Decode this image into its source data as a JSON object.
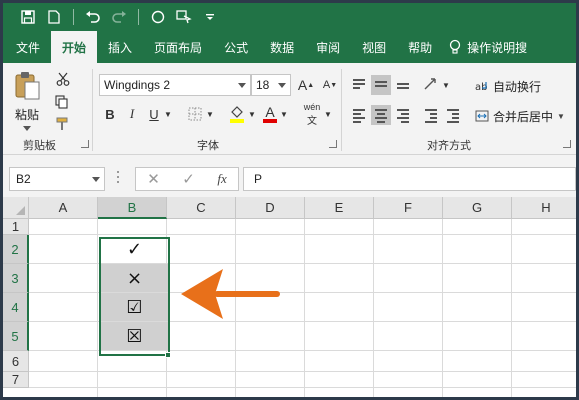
{
  "quick_access": {
    "icons": [
      "save-icon",
      "new-document-icon",
      "undo-icon",
      "redo-icon",
      "shape-icon",
      "touch-mode-icon",
      "customize-icon"
    ]
  },
  "tabs": [
    {
      "label": "文件",
      "active": false
    },
    {
      "label": "开始",
      "active": true
    },
    {
      "label": "插入",
      "active": false
    },
    {
      "label": "页面布局",
      "active": false
    },
    {
      "label": "公式",
      "active": false
    },
    {
      "label": "数据",
      "active": false
    },
    {
      "label": "审阅",
      "active": false
    },
    {
      "label": "视图",
      "active": false
    },
    {
      "label": "帮助",
      "active": false
    },
    {
      "label": "操作说明搜",
      "active": false
    }
  ],
  "ribbon": {
    "clipboard": {
      "paste_label": "粘贴",
      "group_label": "剪贴板"
    },
    "font": {
      "font_name": "Wingdings 2",
      "font_size": "18",
      "bold": "B",
      "italic": "I",
      "underline": "U",
      "font_color_glyph": "A",
      "phonetic": "wén",
      "group_label": "字体"
    },
    "alignment": {
      "wrap_text": "自动换行",
      "merge_center": "合并后居中",
      "group_label": "对齐方式"
    }
  },
  "formula_bar": {
    "name_box": "B2",
    "fx": "fx",
    "formula": "P"
  },
  "grid": {
    "columns": [
      "A",
      "B",
      "C",
      "D",
      "E",
      "F",
      "G",
      "H"
    ],
    "rows": [
      "1",
      "2",
      "3",
      "4",
      "5",
      "6",
      "7"
    ],
    "selected_column": "B",
    "cells_b": [
      {
        "row": "2",
        "value": "✓",
        "shaded": false
      },
      {
        "row": "3",
        "value": "×",
        "shaded": true
      },
      {
        "row": "4",
        "value": "☑",
        "shaded": true
      },
      {
        "row": "5",
        "value": "☒",
        "shaded": true
      }
    ]
  },
  "colors": {
    "excel_green": "#217346",
    "arrow_orange": "#e8701a",
    "frame": "#2d3a4a"
  }
}
